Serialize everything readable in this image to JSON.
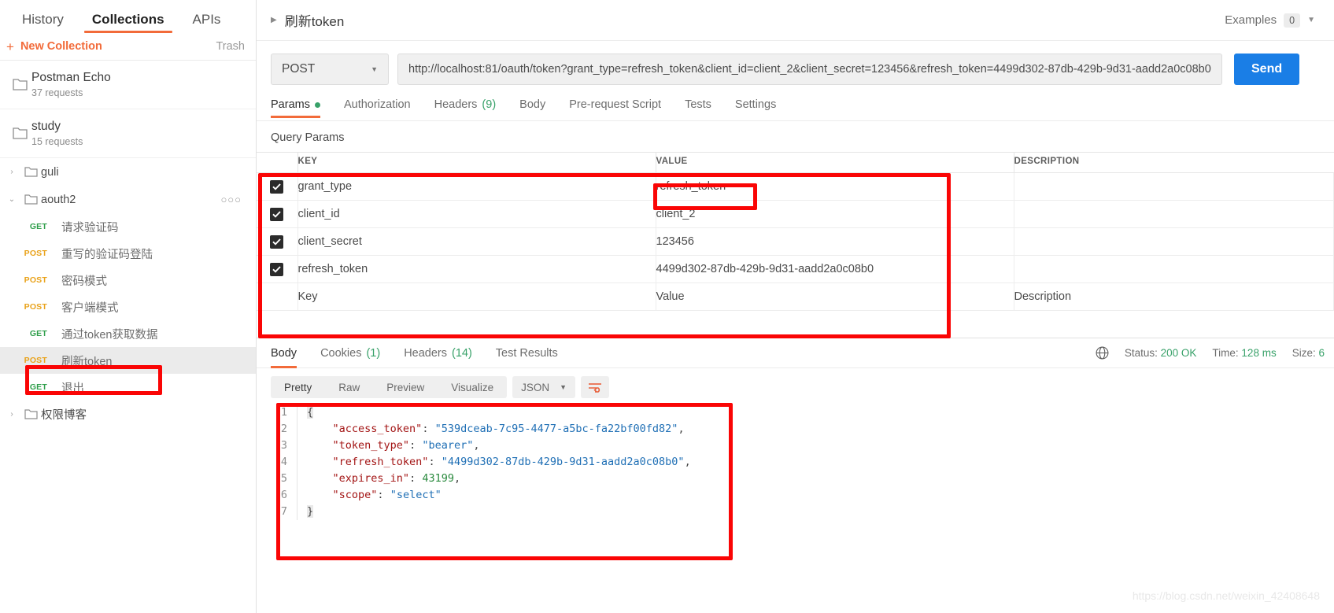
{
  "sidebar": {
    "tabs": [
      {
        "label": "History",
        "active": false
      },
      {
        "label": "Collections",
        "active": true
      },
      {
        "label": "APIs",
        "active": false
      }
    ],
    "new_collection_label": "New Collection",
    "new_collection_plus": "+",
    "trash_label": "Trash",
    "collections": [
      {
        "name": "Postman Echo",
        "requests": "37 requests"
      },
      {
        "name": "study",
        "requests": "15 requests"
      }
    ],
    "folders": [
      {
        "name": "guli",
        "caret": "›",
        "expanded": false
      },
      {
        "name": "aouth2",
        "caret": "⌄",
        "expanded": true,
        "dots": "○○○"
      }
    ],
    "requests": [
      {
        "method": "GET",
        "name": "请求验证码",
        "selected": false
      },
      {
        "method": "POST",
        "name": "重写的验证码登陆",
        "selected": false
      },
      {
        "method": "POST",
        "name": "密码模式",
        "selected": false
      },
      {
        "method": "POST",
        "name": "客户端模式",
        "selected": false
      },
      {
        "method": "GET",
        "name": "通过token获取数据",
        "selected": false
      },
      {
        "method": "POST",
        "name": "刷新token",
        "selected": true
      },
      {
        "method": "GET",
        "name": "退出",
        "selected": false
      }
    ],
    "last_folder": {
      "name": "权限博客",
      "caret": "›"
    }
  },
  "request_header": {
    "caret": "▶",
    "title": "刷新token",
    "examples_label": "Examples",
    "examples_count": "0",
    "chevron": "▼"
  },
  "url_bar": {
    "method": "POST",
    "method_chevron": "▼",
    "url": "http://localhost:81/oauth/token?grant_type=refresh_token&client_id=client_2&client_secret=123456&refresh_token=4499d302-87db-429b-9d31-aadd2a0c08b0",
    "send_label": "Send"
  },
  "request_tabs": [
    {
      "label": "Params",
      "active": true,
      "dot": true
    },
    {
      "label": "Authorization",
      "active": false
    },
    {
      "label": "Headers",
      "active": false,
      "count": "(9)"
    },
    {
      "label": "Body",
      "active": false
    },
    {
      "label": "Pre-request Script",
      "active": false
    },
    {
      "label": "Tests",
      "active": false
    },
    {
      "label": "Settings",
      "active": false
    }
  ],
  "query_params": {
    "section_label": "Query Params",
    "columns": [
      "KEY",
      "VALUE",
      "DESCRIPTION"
    ],
    "rows": [
      {
        "checked": true,
        "key": "grant_type",
        "value": "refresh_token",
        "description": ""
      },
      {
        "checked": true,
        "key": "client_id",
        "value": "client_2",
        "description": ""
      },
      {
        "checked": true,
        "key": "client_secret",
        "value": "123456",
        "description": ""
      },
      {
        "checked": true,
        "key": "refresh_token",
        "value": "4499d302-87db-429b-9d31-aadd2a0c08b0",
        "description": ""
      }
    ],
    "placeholder_row": {
      "key": "Key",
      "value": "Value",
      "description": "Description"
    }
  },
  "response": {
    "tabs": [
      {
        "label": "Body",
        "active": true
      },
      {
        "label": "Cookies",
        "active": false,
        "count": "(1)"
      },
      {
        "label": "Headers",
        "active": false,
        "count": "(14)"
      },
      {
        "label": "Test Results",
        "active": false
      }
    ],
    "globe_icon": "globe-icon",
    "status_label": "Status:",
    "status_value": "200 OK",
    "time_label": "Time:",
    "time_value": "128 ms",
    "size_label": "Size:",
    "size_value": "6",
    "toolbar": {
      "views": [
        {
          "label": "Pretty",
          "active": true
        },
        {
          "label": "Raw",
          "active": false
        },
        {
          "label": "Preview",
          "active": false
        },
        {
          "label": "Visualize",
          "active": false
        }
      ],
      "format": "JSON",
      "format_chevron": "▼",
      "wrap_icon": "word-wrap-icon"
    },
    "body_lines": [
      {
        "n": "1",
        "tokens": [
          {
            "t": "brace",
            "v": "{"
          }
        ]
      },
      {
        "n": "2",
        "tokens": [
          {
            "t": "p",
            "v": "    "
          },
          {
            "t": "k",
            "v": "\"access_token\""
          },
          {
            "t": "p",
            "v": ": "
          },
          {
            "t": "s",
            "v": "\"539dceab-7c95-4477-a5bc-fa22bf00fd82\""
          },
          {
            "t": "p",
            "v": ","
          }
        ]
      },
      {
        "n": "3",
        "tokens": [
          {
            "t": "p",
            "v": "    "
          },
          {
            "t": "k",
            "v": "\"token_type\""
          },
          {
            "t": "p",
            "v": ": "
          },
          {
            "t": "s",
            "v": "\"bearer\""
          },
          {
            "t": "p",
            "v": ","
          }
        ]
      },
      {
        "n": "4",
        "tokens": [
          {
            "t": "p",
            "v": "    "
          },
          {
            "t": "k",
            "v": "\"refresh_token\""
          },
          {
            "t": "p",
            "v": ": "
          },
          {
            "t": "s",
            "v": "\"4499d302-87db-429b-9d31-aadd2a0c08b0\""
          },
          {
            "t": "p",
            "v": ","
          }
        ]
      },
      {
        "n": "5",
        "tokens": [
          {
            "t": "p",
            "v": "    "
          },
          {
            "t": "k",
            "v": "\"expires_in\""
          },
          {
            "t": "p",
            "v": ": "
          },
          {
            "t": "n",
            "v": "43199"
          },
          {
            "t": "p",
            "v": ","
          }
        ]
      },
      {
        "n": "6",
        "tokens": [
          {
            "t": "p",
            "v": "    "
          },
          {
            "t": "k",
            "v": "\"scope\""
          },
          {
            "t": "p",
            "v": ": "
          },
          {
            "t": "s",
            "v": "\"select\""
          }
        ]
      },
      {
        "n": "7",
        "tokens": [
          {
            "t": "brace",
            "v": "}"
          }
        ]
      }
    ]
  },
  "watermark": "https://blog.csdn.net/weixin_42408648",
  "annotations": {
    "highlight_color": "#fa0505",
    "boxes": [
      {
        "name": "sidebar-request-highlight"
      },
      {
        "name": "params-table-highlight"
      },
      {
        "name": "grant-type-value-highlight"
      },
      {
        "name": "response-body-highlight"
      }
    ]
  },
  "colors": {
    "accent": "#f26b3a",
    "send": "#1a7ee6",
    "get": "#2e9e4a",
    "post": "#e9a21a",
    "ok": "#38a169"
  }
}
